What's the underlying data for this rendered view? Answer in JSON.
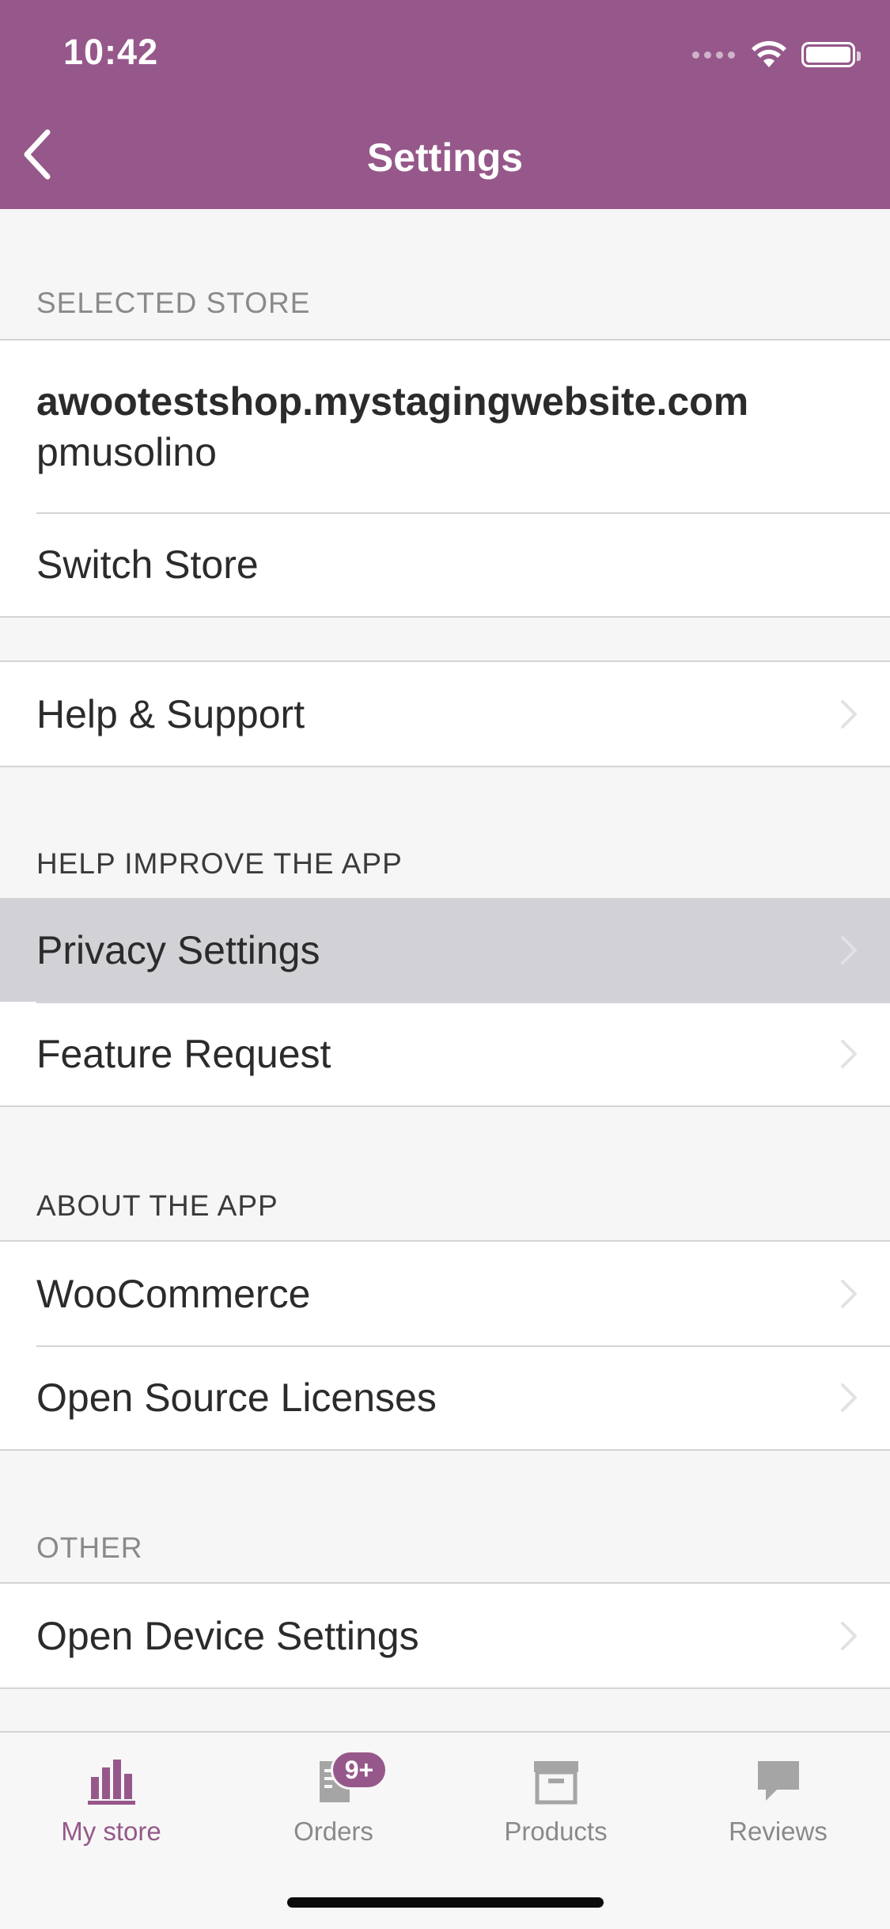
{
  "status_bar": {
    "time": "10:42"
  },
  "nav": {
    "title": "Settings"
  },
  "sections": {
    "selected_store": {
      "header": "SELECTED STORE",
      "store_url": "awootestshop.mystagingwebsite.com",
      "store_user": "pmusolino",
      "switch_store": "Switch Store"
    },
    "support": {
      "help_support": "Help & Support"
    },
    "help_improve": {
      "header": "HELP IMPROVE THE APP",
      "privacy_settings": "Privacy Settings",
      "feature_request": "Feature Request"
    },
    "about": {
      "header": "ABOUT THE APP",
      "woocommerce": "WooCommerce",
      "licenses": "Open Source Licenses"
    },
    "other": {
      "header": "OTHER",
      "device_settings": "Open Device Settings"
    }
  },
  "tabbar": {
    "my_store": "My store",
    "orders": "Orders",
    "orders_badge": "9+",
    "products": "Products",
    "reviews": "Reviews"
  },
  "colors": {
    "brand": "#96588a",
    "highlight": "#d1d1d6",
    "separator": "#d4d4d8"
  },
  "icons": [
    "chevron-left-icon",
    "wifi-icon",
    "battery-icon",
    "chevron-right-icon",
    "bar-chart-icon",
    "orders-icon",
    "archive-box-icon",
    "speech-bubble-icon"
  ]
}
